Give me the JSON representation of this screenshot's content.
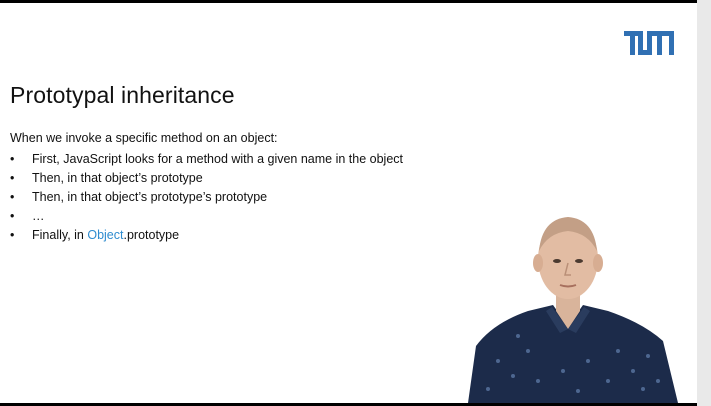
{
  "slide": {
    "logo_text": "TUM",
    "title": "Prototypal inheritance",
    "intro": "When we invoke a specific method on an object:",
    "bullets": [
      {
        "marker": "•",
        "text": "First, JavaScript looks for a method with a given name in the object"
      },
      {
        "marker": "•",
        "text": "Then, in that object’s prototype"
      },
      {
        "marker": "•",
        "text": "Then, in that object’s prototype’s prototype"
      },
      {
        "marker": "•",
        "text": "…"
      },
      {
        "marker": "•",
        "text_prefix": "Finally, in ",
        "link_text": "Object",
        "text_suffix": ".prototype"
      }
    ]
  },
  "colors": {
    "logo": "#3070b3",
    "link": "#2f8ccf",
    "shirt": "#1c2b4a"
  },
  "presenter": {
    "icon": "presenter-video-icon"
  }
}
